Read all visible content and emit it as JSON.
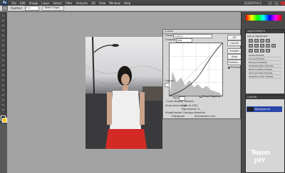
{
  "app": {
    "logo": "Ps"
  },
  "menu": [
    "File",
    "Edit",
    "Image",
    "Layer",
    "Select",
    "Filter",
    "Analysis",
    "3D",
    "View",
    "Window",
    "Help"
  ],
  "workspace_label": "ESSENTIALS",
  "options": {
    "label1": "Feather:",
    "value1": "0 px",
    "btn1": "Refine Edge..."
  },
  "curves": {
    "title": "Curves",
    "preset_label": "Preset:",
    "preset_value": "Custom",
    "channel_label": "Channel:",
    "channel_value": "RGB",
    "buttons": [
      "OK",
      "Cancel",
      "Smooth",
      "Auto",
      "Options..."
    ],
    "preview_label": "Preview",
    "show_clipping": "Show Clipping",
    "output_label": "Output:",
    "input_label": "Input:",
    "curve_display": "Curve Display Options",
    "show_amount": "Show Amount of:",
    "light": "Light (0-255)",
    "pigment": "Pigment/Ink %",
    "show_label": "Show:",
    "channel_overlays": "Channel Overlays",
    "baseline": "Baseline",
    "histogram": "Histogram",
    "intersection": "Intersection Line"
  },
  "adjustments": {
    "header": "ADJUSTMENTS",
    "sub": "Add an adjustment",
    "list": [
      "Levels Presets",
      "Curves Presets",
      "Exposure Presets",
      "Hue/Saturation Presets",
      "Black & White Presets",
      "Channel Mixer Presets",
      "Selective Color Presets"
    ]
  },
  "layers": {
    "header": "LAYERS",
    "row": "Background"
  },
  "watermark": {
    "line1": "Toson",
    "line2": "JHY"
  },
  "colors": {
    "fg": "#000000",
    "bg": "#f6c200",
    "layer_sel": "#2b47a8"
  }
}
